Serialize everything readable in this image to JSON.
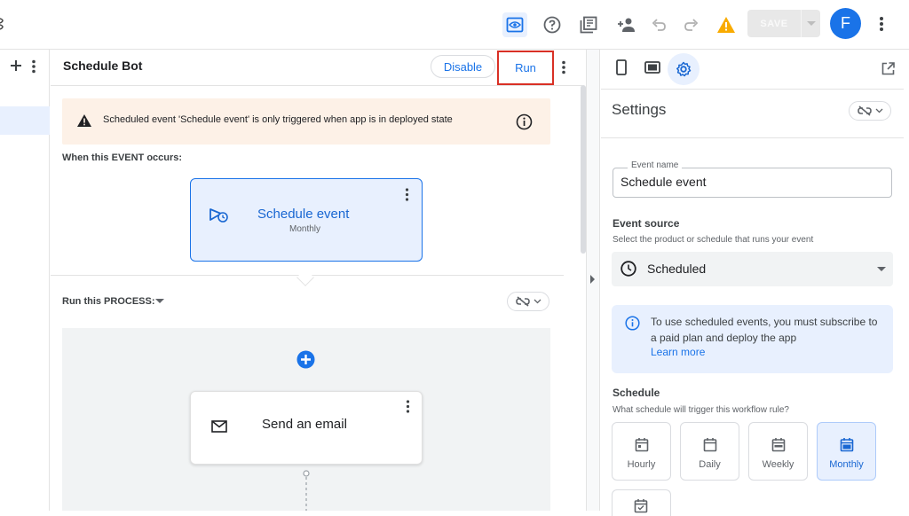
{
  "topbar": {
    "avatar_letter": "F",
    "save_label": "SAVE",
    "warning_color": "#f9ab00",
    "accent_color": "#1a73e8"
  },
  "center": {
    "bot_title": "Schedule Bot",
    "disable_label": "Disable",
    "run_label": "Run",
    "warning_text": "Scheduled event 'Schedule event' is only triggered when app is in deployed state",
    "event_section_label": "When this EVENT occurs:",
    "event_card": {
      "title": "Schedule event",
      "subtitle": "Monthly"
    },
    "process_section_label": "Run this PROCESS:",
    "email_card": {
      "title": "Send an email"
    }
  },
  "settings": {
    "title": "Settings",
    "event_name_label": "Event name",
    "event_name_value": "Schedule event",
    "event_source_label": "Event source",
    "event_source_help": "Select the product or schedule that runs your event",
    "event_source_value": "Scheduled",
    "info_text": "To use scheduled events, you must subscribe to a paid plan and deploy the app",
    "info_link": "Learn more",
    "schedule_label": "Schedule",
    "schedule_help": "What schedule will trigger this workflow rule?",
    "schedule_options": [
      {
        "label": "Hourly",
        "selected": false
      },
      {
        "label": "Daily",
        "selected": false
      },
      {
        "label": "Weekly",
        "selected": false
      },
      {
        "label": "Monthly",
        "selected": true
      }
    ]
  }
}
